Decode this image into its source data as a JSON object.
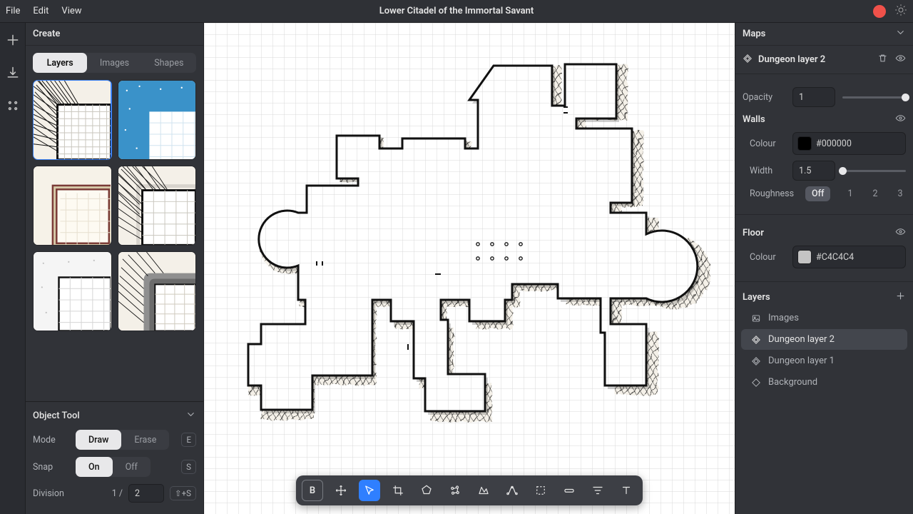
{
  "menus": {
    "file": "File",
    "edit": "Edit",
    "view": "View"
  },
  "title": "Lower Citadel of the Immortal Savant",
  "left": {
    "panel_title": "Create",
    "tabs": {
      "layers": "Layers",
      "images": "Images",
      "shapes": "Shapes"
    },
    "object_tool": {
      "title": "Object Tool",
      "mode_label": "Mode",
      "mode_draw": "Draw",
      "mode_erase": "Erase",
      "mode_key": "E",
      "snap_label": "Snap",
      "snap_on": "On",
      "snap_off": "Off",
      "snap_key": "S",
      "division_label": "Division",
      "division_frac": "1 /",
      "division_value": "2",
      "division_key": "⇧+S"
    }
  },
  "right": {
    "maps_title": "Maps",
    "layer_name": "Dungeon layer 2",
    "opacity_label": "Opacity",
    "opacity_value": "1",
    "walls_title": "Walls",
    "colour_label": "Colour",
    "walls_colour": "#000000",
    "width_label": "Width",
    "width_value": "1.5",
    "roughness_label": "Roughness",
    "roughness_off": "Off",
    "roughness_opts": [
      "1",
      "2",
      "3"
    ],
    "floor_title": "Floor",
    "floor_colour": "#C4C4C4",
    "layers_title": "Layers",
    "layers": [
      {
        "name": "Images"
      },
      {
        "name": "Dungeon layer 2"
      },
      {
        "name": "Dungeon layer 1"
      },
      {
        "name": "Background"
      }
    ]
  }
}
